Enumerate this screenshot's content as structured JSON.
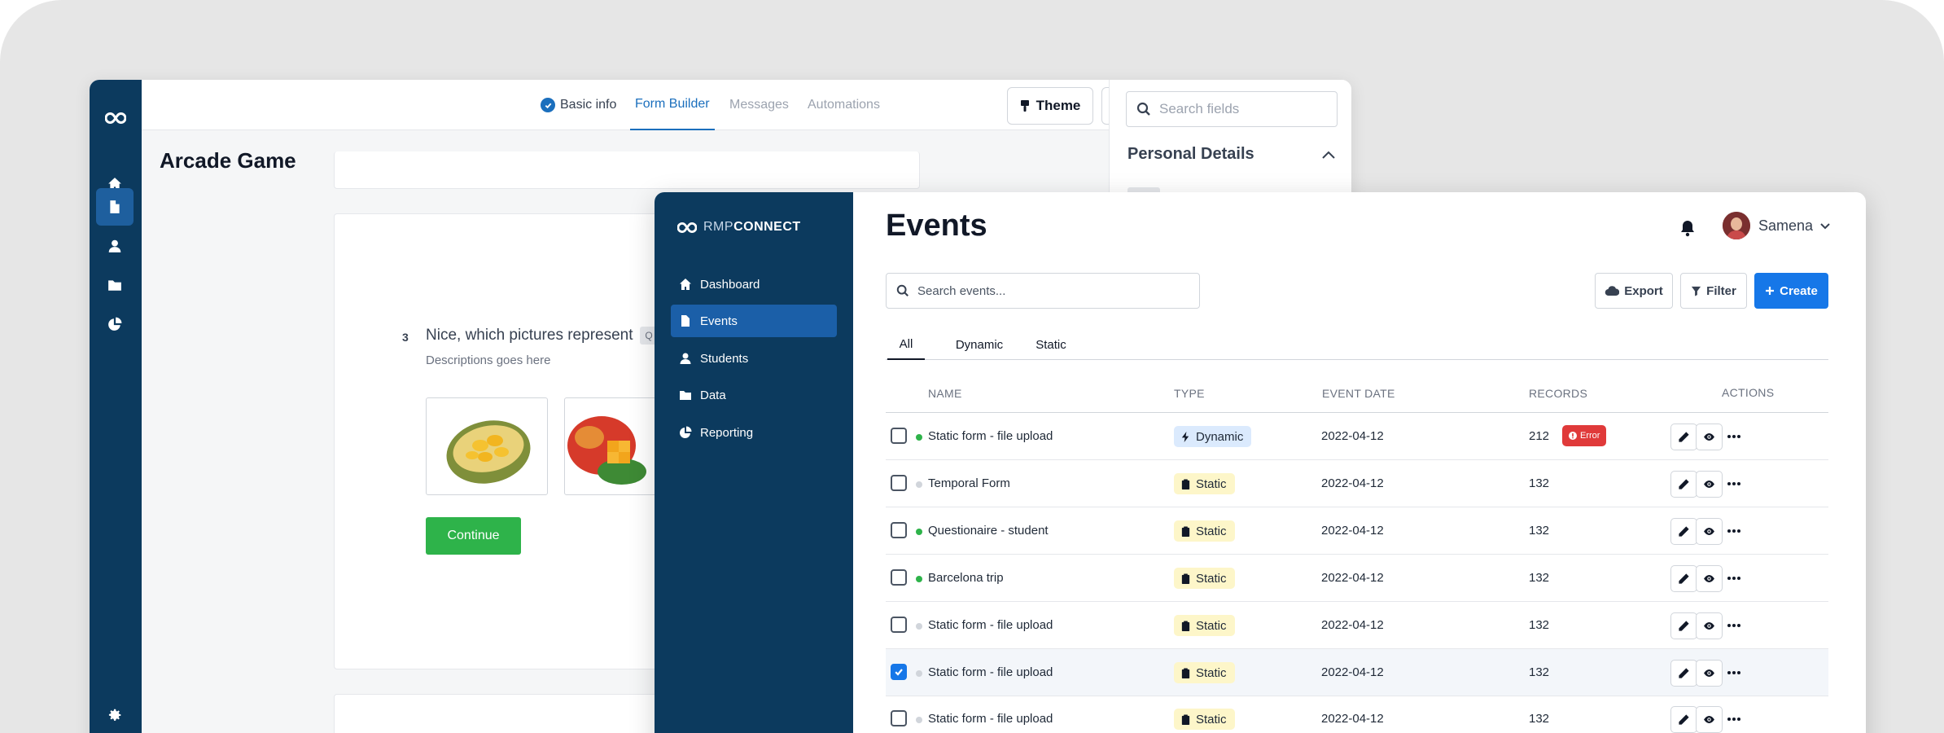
{
  "back_window": {
    "tabs": [
      {
        "label": "Basic info"
      },
      {
        "label": "Form Builder"
      },
      {
        "label": "Messages"
      },
      {
        "label": "Automations"
      }
    ],
    "theme_label": "Theme",
    "search_placeholder": "Search fields",
    "section_title": "Personal Details",
    "form_title": "Arcade Game",
    "question": {
      "number": "3",
      "text": "Nice, which pictures represent",
      "chip": "Q",
      "description": "Descriptions goes here"
    },
    "continue_label": "Continue"
  },
  "front_window": {
    "brand_thin": "RMP",
    "brand_bold": "CONNECT",
    "nav": [
      {
        "label": "Dashboard",
        "icon": "home-icon"
      },
      {
        "label": "Events",
        "icon": "document-icon",
        "active": true
      },
      {
        "label": "Students",
        "icon": "user-icon"
      },
      {
        "label": "Data",
        "icon": "folder-icon"
      },
      {
        "label": "Reporting",
        "icon": "pie-chart-icon"
      }
    ],
    "title": "Events",
    "user_name": "Samena",
    "search_placeholder": "Search events...",
    "export_label": "Export",
    "filter_label": "Filter",
    "create_label": "Create",
    "filter_tabs": [
      "All",
      "Dynamic",
      "Static"
    ],
    "columns": {
      "name": "Name",
      "type": "Type",
      "date": "Event date",
      "records": "Records",
      "actions": "Actions"
    },
    "rows": [
      {
        "name": "Static form - file upload",
        "type": "Dynamic",
        "date": "2022-04-12",
        "records": "212",
        "badge": "Error",
        "active": true,
        "checked": false
      },
      {
        "name": "Temporal Form",
        "type": "Static",
        "date": "2022-04-12",
        "records": "132",
        "active": false,
        "checked": false
      },
      {
        "name": "Questionaire - student",
        "type": "Static",
        "date": "2022-04-12",
        "records": "132",
        "active": true,
        "checked": false
      },
      {
        "name": "Barcelona trip",
        "type": "Static",
        "date": "2022-04-12",
        "records": "132",
        "active": true,
        "checked": false
      },
      {
        "name": "Static form - file upload",
        "type": "Static",
        "date": "2022-04-12",
        "records": "132",
        "active": false,
        "checked": false
      },
      {
        "name": "Static form - file upload",
        "type": "Static",
        "date": "2022-04-12",
        "records": "132",
        "active": false,
        "checked": true
      },
      {
        "name": "Static form - file upload",
        "type": "Static",
        "date": "2022-04-12",
        "records": "132",
        "active": false,
        "checked": false
      }
    ],
    "colors": {
      "active_dot": "#2eb34a",
      "inactive_dot": "#d1d5db",
      "primary": "#1677e8",
      "sidebar": "#0c3a5e"
    }
  }
}
